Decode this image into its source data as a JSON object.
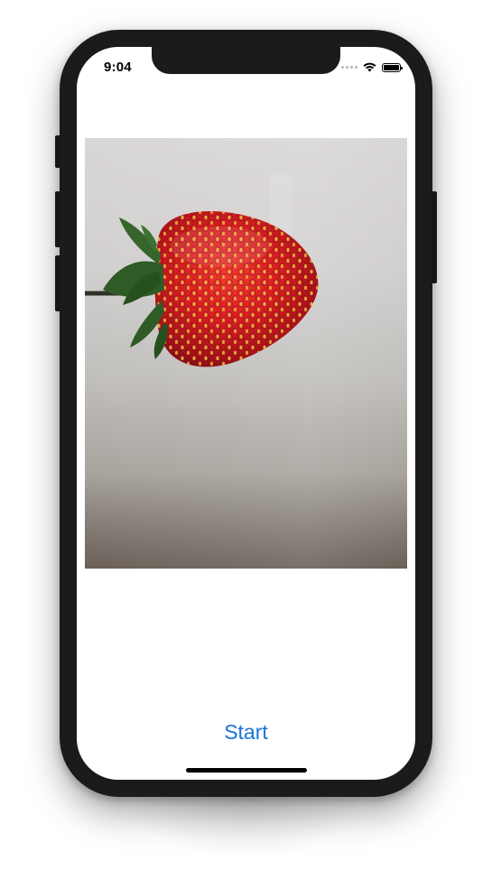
{
  "status_bar": {
    "time": "9:04",
    "icons": [
      "signal-dots-icon",
      "wifi-icon",
      "battery-icon"
    ],
    "battery_level": 1.0
  },
  "photo": {
    "subject": "strawberry-image"
  },
  "action": {
    "start_label": "Start"
  },
  "colors": {
    "accent": "#1d72d8",
    "device_frame": "#1b1b1b",
    "strawberry_red": "#d81f22",
    "leaf_green": "#2f5b26"
  }
}
